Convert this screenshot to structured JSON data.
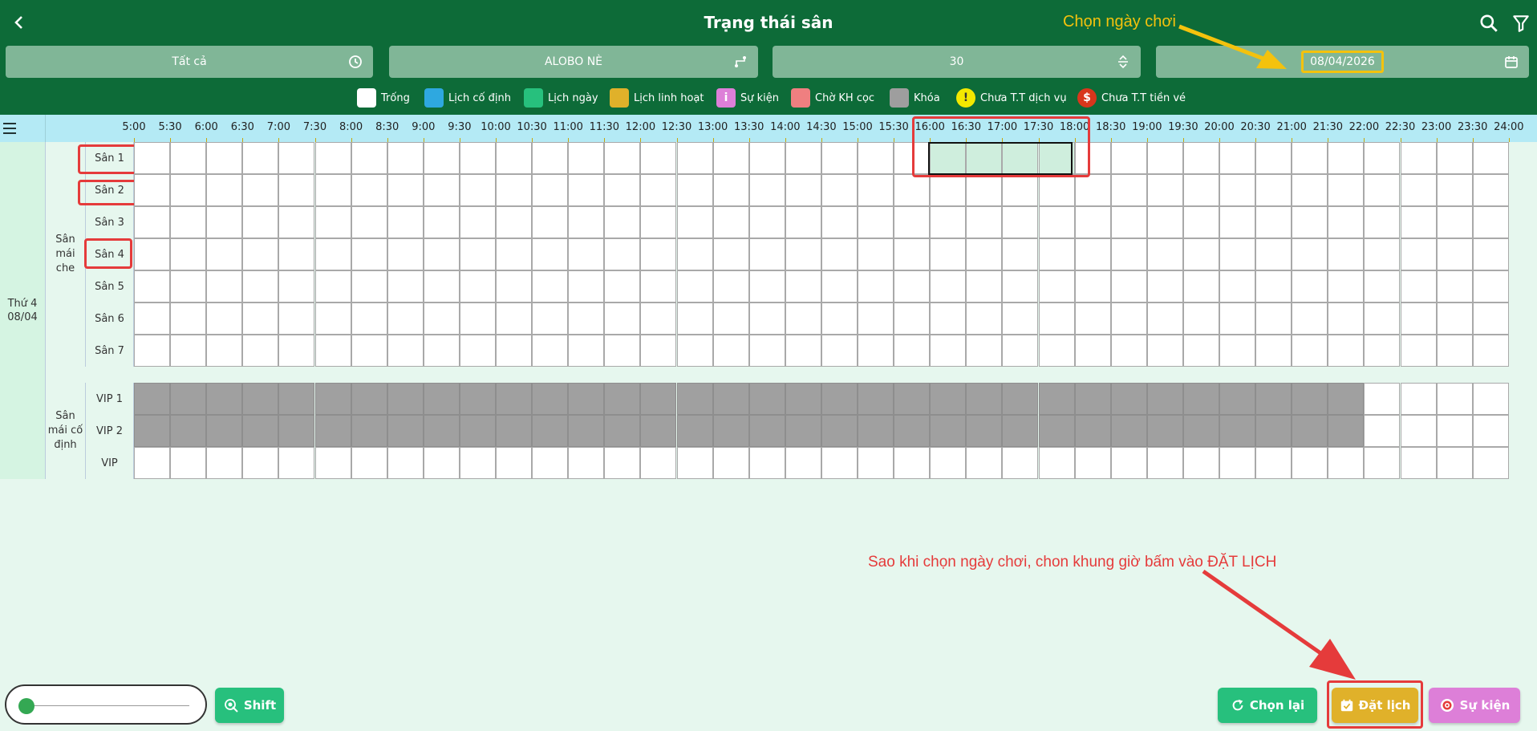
{
  "header": {
    "title": "Trạng thái sân",
    "annotation_top": "Chọn ngày chơi"
  },
  "filters": {
    "area": "Tất cả",
    "venue": "ALOBO NÈ",
    "duration": "30",
    "date": "08/04/2026"
  },
  "legend": [
    {
      "label": "Trống",
      "color": "#ffffff",
      "glyph": ""
    },
    {
      "label": "Lịch cố định",
      "color": "#2ea8e0",
      "glyph": ""
    },
    {
      "label": "Lịch ngày",
      "color": "#27c07d",
      "glyph": ""
    },
    {
      "label": "Lịch linh hoạt",
      "color": "#e0b12a",
      "glyph": ""
    },
    {
      "label": "Sự kiện",
      "color": "#dd7fd8",
      "glyph": "i"
    },
    {
      "label": "Chờ KH cọc",
      "color": "#ef7f80",
      "glyph": ""
    },
    {
      "label": "Khóa",
      "color": "#9e9e9e",
      "glyph": ""
    },
    {
      "label": "Chưa T.T dịch vụ",
      "color": "#f3e800",
      "glyph": "!"
    },
    {
      "label": "Chưa T.T tiền vé",
      "color": "#d8361c",
      "glyph": "$"
    }
  ],
  "times": [
    "5:00",
    "5:30",
    "6:00",
    "6:30",
    "7:00",
    "7:30",
    "8:00",
    "8:30",
    "9:00",
    "9:30",
    "10:00",
    "10:30",
    "11:00",
    "11:30",
    "12:00",
    "12:30",
    "13:00",
    "13:30",
    "14:00",
    "14:30",
    "15:00",
    "15:30",
    "16:00",
    "16:30",
    "17:00",
    "17:30",
    "18:00",
    "18:30",
    "19:00",
    "19:30",
    "20:00",
    "20:30",
    "21:00",
    "21:30",
    "22:00",
    "22:30",
    "23:00",
    "23:30",
    "24:00"
  ],
  "day": {
    "weekday": "Thứ 4",
    "date": "08/04"
  },
  "groups": [
    {
      "name": "Sân mái che",
      "courts": [
        "Sân 1",
        "Sân 2",
        "Sân 3",
        "Sân 4",
        "Sân 5",
        "Sân 6",
        "Sân 7"
      ]
    },
    {
      "name": "Sân mái cố định",
      "courts": [
        "VIP 1",
        "VIP 2",
        "VIP"
      ]
    }
  ],
  "slots": {
    "count": 38,
    "selected": {
      "court": "Sân 1",
      "from": "16:00",
      "to": "18:00"
    },
    "locked": [
      {
        "court": "VIP 1",
        "from": "5:00",
        "to": "22:00"
      },
      {
        "court": "VIP 2",
        "from": "5:00",
        "to": "22:00"
      }
    ]
  },
  "annotation_bottom": "Sao khi chọn ngày chơi, chon khung giờ bấm vào ĐẶT LỊCH",
  "buttons": {
    "shift": "Shift",
    "reset": "Chọn lại",
    "book": "Đặt lịch",
    "event": "Sự kiện"
  },
  "colors": {
    "header": "#0d6b38",
    "locked": "#a0a0a0",
    "selected": "#cfeedd",
    "reset_btn": "#27c07d",
    "book_btn": "#e0b12a",
    "event_btn": "#dd7fd8",
    "highlight": "#e53b3b",
    "annotation_arrow": "#f4c20d"
  }
}
